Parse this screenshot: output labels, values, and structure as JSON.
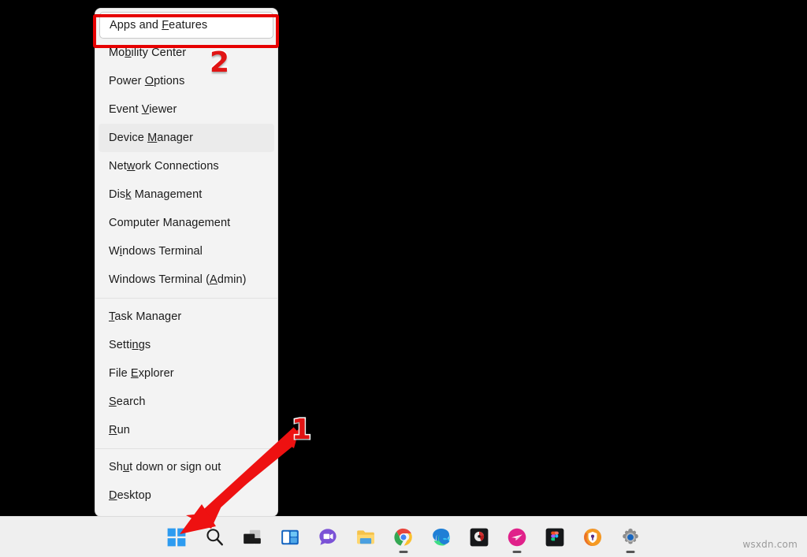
{
  "window": {
    "title": "Windows 11 Desktop",
    "background_color": "#000000"
  },
  "context_menu": {
    "name": "Win+X Quick Link Menu",
    "background_color": "#f3f3f3",
    "sections": [
      {
        "items": [
          {
            "label": "Apps and Features",
            "accel": "F",
            "state": "selected"
          },
          {
            "label": "Mobility Center",
            "accel": "b",
            "state": "normal"
          },
          {
            "label": "Power Options",
            "accel": "O",
            "state": "normal"
          },
          {
            "label": "Event Viewer",
            "accel": "V",
            "state": "normal"
          },
          {
            "label": "Device Manager",
            "accel": "M",
            "state": "hover"
          },
          {
            "label": "Network Connections",
            "accel": "w",
            "state": "normal"
          },
          {
            "label": "Disk Management",
            "accel": "k",
            "state": "normal"
          },
          {
            "label": "Computer Management",
            "accel": "g",
            "state": "normal"
          },
          {
            "label": "Windows Terminal",
            "accel": "i",
            "state": "normal"
          },
          {
            "label": "Windows Terminal (Admin)",
            "accel": "A",
            "state": "normal"
          }
        ]
      },
      {
        "items": [
          {
            "label": "Task Manager",
            "accel": "T",
            "state": "normal"
          },
          {
            "label": "Settings",
            "accel": "n",
            "state": "normal"
          },
          {
            "label": "File Explorer",
            "accel": "E",
            "state": "normal"
          },
          {
            "label": "Search",
            "accel": "S",
            "state": "normal"
          },
          {
            "label": "Run",
            "accel": "R",
            "state": "normal"
          }
        ]
      },
      {
        "items": [
          {
            "label": "Shut down or sign out",
            "accel": "u",
            "state": "normal"
          },
          {
            "label": "Desktop",
            "accel": "D",
            "state": "normal"
          }
        ]
      }
    ]
  },
  "annotations": {
    "color": "#e11414",
    "step_one": "1",
    "step_two": "2",
    "highlight_color": "#e60000",
    "arrow_target": "start-button"
  },
  "taskbar": {
    "background_color": "#efefef",
    "items": [
      {
        "name": "start-button",
        "label": "Start",
        "icon": "windows-logo-icon",
        "active": false
      },
      {
        "name": "search-button",
        "label": "Search",
        "icon": "magnifier-icon",
        "active": false
      },
      {
        "name": "task-view-button",
        "label": "Task View",
        "icon": "task-view-icon",
        "active": false
      },
      {
        "name": "widgets-button",
        "label": "Widgets",
        "icon": "widgets-icon",
        "active": false
      },
      {
        "name": "chat-button",
        "label": "Chat",
        "icon": "chat-video-icon",
        "active": false
      },
      {
        "name": "file-explorer-button",
        "label": "File Explorer",
        "icon": "folder-icon",
        "active": false
      },
      {
        "name": "chrome-button",
        "label": "Google Chrome",
        "icon": "chrome-icon",
        "active": true
      },
      {
        "name": "edge-button",
        "label": "Microsoft Edge",
        "icon": "edge-icon",
        "active": false
      },
      {
        "name": "dark-app-button",
        "label": "Recording App",
        "icon": "record-dark-icon",
        "active": false
      },
      {
        "name": "pink-app-button",
        "label": "Messaging App",
        "icon": "pink-plane-icon",
        "active": true
      },
      {
        "name": "figma-button",
        "label": "Figma",
        "icon": "figma-icon",
        "active": false
      },
      {
        "name": "password-manager-button",
        "label": "Password Manager",
        "icon": "lock-shield-icon",
        "active": false
      },
      {
        "name": "settings-button",
        "label": "Settings",
        "icon": "gear-icon",
        "active": true
      }
    ]
  },
  "watermark": {
    "text": "wsxdn.com"
  }
}
